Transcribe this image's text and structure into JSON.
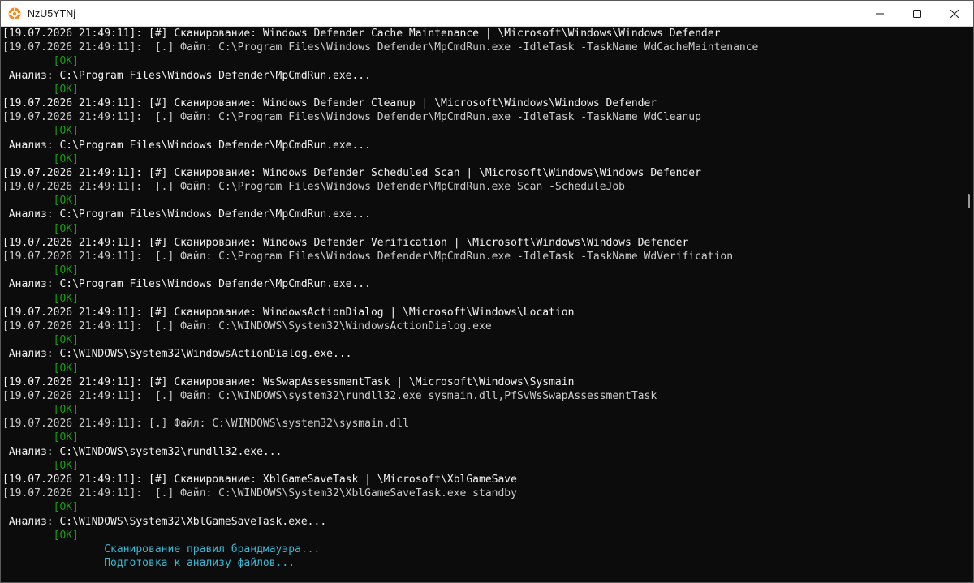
{
  "window": {
    "title": "NzU5YTNj",
    "icon": "orange-gear-icon",
    "controls": [
      "minimize-icon",
      "maximize-icon",
      "close-icon"
    ]
  },
  "colors": {
    "background": "#0c0c0c",
    "text": "#cccccc",
    "ok": "#13a10e",
    "accent_cyan": "#3ab8d4"
  },
  "console": {
    "lines": [
      {
        "text": "[19.07.2026 21:49:11]: [#] Сканирование: Windows Defender Cache Maintenance | \\Microsoft\\Windows\\Windows Defender",
        "style": "white"
      },
      {
        "text": "[19.07.2026 21:49:11]:  [.] Файл: C:\\Program Files\\Windows Defender\\MpCmdRun.exe -IdleTask -TaskName WdCacheMaintenance",
        "style": "normal"
      },
      {
        "text": "        [OK]",
        "style": "ok"
      },
      {
        "text": " Анализ: C:\\Program Files\\Windows Defender\\MpCmdRun.exe...",
        "style": "white"
      },
      {
        "text": "        [OK]",
        "style": "ok"
      },
      {
        "text": "[19.07.2026 21:49:11]: [#] Сканирование: Windows Defender Cleanup | \\Microsoft\\Windows\\Windows Defender",
        "style": "white"
      },
      {
        "text": "[19.07.2026 21:49:11]:  [.] Файл: C:\\Program Files\\Windows Defender\\MpCmdRun.exe -IdleTask -TaskName WdCleanup",
        "style": "normal"
      },
      {
        "text": "        [OK]",
        "style": "ok"
      },
      {
        "text": " Анализ: C:\\Program Files\\Windows Defender\\MpCmdRun.exe...",
        "style": "white"
      },
      {
        "text": "        [OK]",
        "style": "ok"
      },
      {
        "text": "[19.07.2026 21:49:11]: [#] Сканирование: Windows Defender Scheduled Scan | \\Microsoft\\Windows\\Windows Defender",
        "style": "white"
      },
      {
        "text": "[19.07.2026 21:49:11]:  [.] Файл: C:\\Program Files\\Windows Defender\\MpCmdRun.exe Scan -ScheduleJob",
        "style": "normal"
      },
      {
        "text": "        [OK]",
        "style": "ok"
      },
      {
        "text": " Анализ: C:\\Program Files\\Windows Defender\\MpCmdRun.exe...",
        "style": "white"
      },
      {
        "text": "        [OK]",
        "style": "ok"
      },
      {
        "text": "[19.07.2026 21:49:11]: [#] Сканирование: Windows Defender Verification | \\Microsoft\\Windows\\Windows Defender",
        "style": "white"
      },
      {
        "text": "[19.07.2026 21:49:11]:  [.] Файл: C:\\Program Files\\Windows Defender\\MpCmdRun.exe -IdleTask -TaskName WdVerification",
        "style": "normal"
      },
      {
        "text": "        [OK]",
        "style": "ok"
      },
      {
        "text": " Анализ: C:\\Program Files\\Windows Defender\\MpCmdRun.exe...",
        "style": "white"
      },
      {
        "text": "        [OK]",
        "style": "ok"
      },
      {
        "text": "[19.07.2026 21:49:11]: [#] Сканирование: WindowsActionDialog | \\Microsoft\\Windows\\Location",
        "style": "white"
      },
      {
        "text": "[19.07.2026 21:49:11]:  [.] Файл: C:\\WINDOWS\\System32\\WindowsActionDialog.exe",
        "style": "normal"
      },
      {
        "text": "        [OK]",
        "style": "ok"
      },
      {
        "text": " Анализ: C:\\WINDOWS\\System32\\WindowsActionDialog.exe...",
        "style": "white"
      },
      {
        "text": "        [OK]",
        "style": "ok"
      },
      {
        "text": "[19.07.2026 21:49:11]: [#] Сканирование: WsSwapAssessmentTask | \\Microsoft\\Windows\\Sysmain",
        "style": "white"
      },
      {
        "text": "[19.07.2026 21:49:11]:  [.] Файл: C:\\WINDOWS\\system32\\rundll32.exe sysmain.dll,PfSvWsSwapAssessmentTask",
        "style": "normal"
      },
      {
        "text": "        [OK]",
        "style": "ok"
      },
      {
        "text": "[19.07.2026 21:49:11]: [.] Файл: C:\\WINDOWS\\system32\\sysmain.dll",
        "style": "normal"
      },
      {
        "text": "        [OK]",
        "style": "ok"
      },
      {
        "text": " Анализ: C:\\WINDOWS\\system32\\rundll32.exe...",
        "style": "white"
      },
      {
        "text": "        [OK]",
        "style": "ok"
      },
      {
        "text": "[19.07.2026 21:49:11]: [#] Сканирование: XblGameSaveTask | \\Microsoft\\XblGameSave",
        "style": "white"
      },
      {
        "text": "[19.07.2026 21:49:11]:  [.] Файл: C:\\WINDOWS\\System32\\XblGameSaveTask.exe standby",
        "style": "normal"
      },
      {
        "text": "        [OK]",
        "style": "ok"
      },
      {
        "text": " Анализ: C:\\WINDOWS\\System32\\XblGameSaveTask.exe...",
        "style": "white"
      },
      {
        "text": "        [OK]",
        "style": "ok"
      },
      {
        "text": "                Сканирование правил брандмауэра...",
        "style": "cyan"
      },
      {
        "text": "                Подготовка к анализу файлов...",
        "style": "cyan"
      }
    ]
  }
}
